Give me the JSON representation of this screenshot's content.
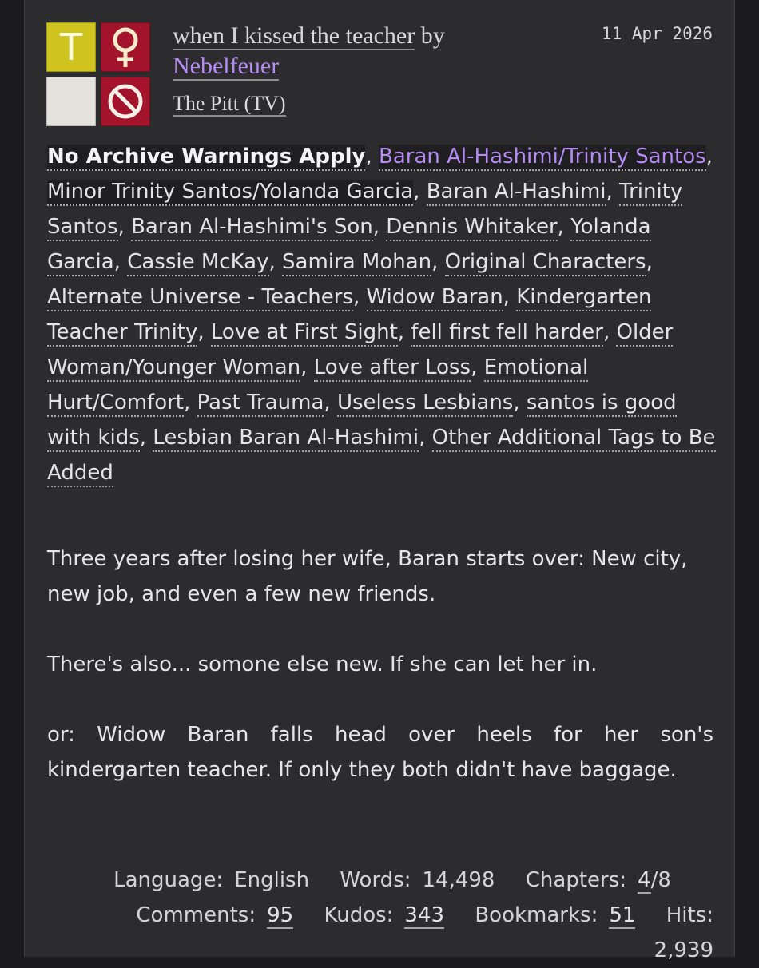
{
  "work": {
    "rating_symbol": "T",
    "title": "when I kissed the teacher",
    "by": "by",
    "author": "Nebelfeuer",
    "fandom": "The Pitt (TV)",
    "date": "11 Apr 2026"
  },
  "tags": [
    {
      "text": "No Archive Warnings Apply",
      "type": "warning"
    },
    {
      "text": "Baran Al-Hashimi/Trinity Santos",
      "type": "relationship"
    },
    {
      "text": "Minor Trinity Santos/Yolanda Garcia",
      "type": "relationship-plain"
    },
    {
      "text": "Baran Al-Hashimi",
      "type": "character"
    },
    {
      "text": "Trinity Santos",
      "type": "character"
    },
    {
      "text": "Baran Al-Hashimi's Son",
      "type": "character"
    },
    {
      "text": "Dennis Whitaker",
      "type": "character"
    },
    {
      "text": "Yolanda Garcia",
      "type": "character"
    },
    {
      "text": "Cassie McKay",
      "type": "character"
    },
    {
      "text": "Samira Mohan",
      "type": "character"
    },
    {
      "text": "Original Characters",
      "type": "character"
    },
    {
      "text": "Alternate Universe - Teachers",
      "type": "freeform"
    },
    {
      "text": "Widow Baran",
      "type": "freeform"
    },
    {
      "text": "Kindergarten Teacher Trinity",
      "type": "freeform"
    },
    {
      "text": "Love at First Sight",
      "type": "freeform"
    },
    {
      "text": "fell first fell harder",
      "type": "freeform"
    },
    {
      "text": "Older Woman/Younger Woman",
      "type": "freeform"
    },
    {
      "text": "Love after Loss",
      "type": "freeform"
    },
    {
      "text": "Emotional Hurt/Comfort",
      "type": "freeform"
    },
    {
      "text": "Past Trauma",
      "type": "freeform"
    },
    {
      "text": "Useless Lesbians",
      "type": "freeform"
    },
    {
      "text": "santos is good with kids",
      "type": "freeform"
    },
    {
      "text": "Lesbian Baran Al-Hashimi",
      "type": "freeform"
    },
    {
      "text": "Other Additional Tags to Be Added",
      "type": "freeform"
    }
  ],
  "summary": {
    "p1": "Three years after losing her wife, Baran starts over: New city, new job, and even a few new friends.",
    "p2": "There's also... somone else new. If she can let her in.",
    "p3": "or: Widow Baran falls head over heels for her son's kindergarten teacher. If only they both didn't have baggage."
  },
  "stats": {
    "language_label": "Language:",
    "language": "English",
    "words_label": "Words:",
    "words": "14,498",
    "chapters_label": "Chapters:",
    "chapters_posted": "4",
    "chapters_total": "/8",
    "comments_label": "Comments:",
    "comments": "95",
    "kudos_label": "Kudos:",
    "kudos": "343",
    "bookmarks_label": "Bookmarks:",
    "bookmarks": "51",
    "hits_label": "Hits:",
    "hits": "2,939"
  },
  "colors": {
    "background": "#2c2c2f",
    "link_purple": "#b58cf2",
    "rating_yellow": "#cfc41f",
    "category_red": "#a3142c"
  },
  "icons": {
    "category": "female-symbol-icon",
    "warning": "blank-warning-icon",
    "complete": "no-entry-icon"
  }
}
